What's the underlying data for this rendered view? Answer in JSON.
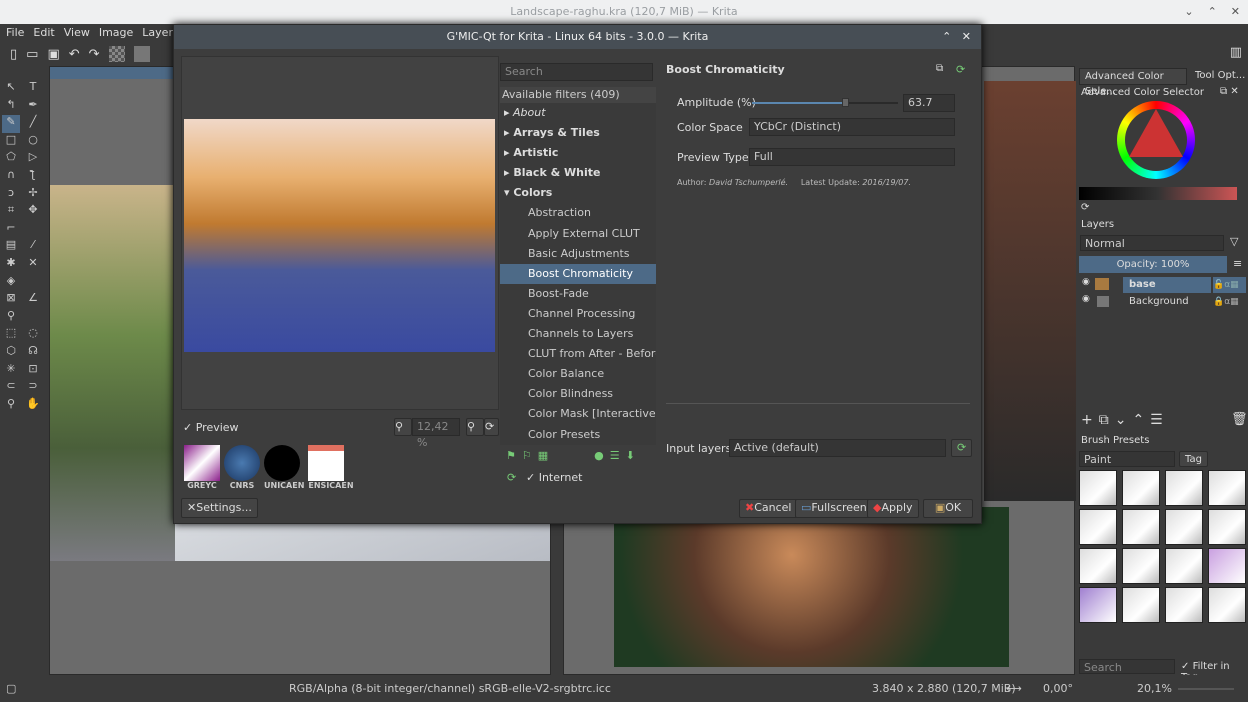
{
  "window": {
    "title": "Landscape-raghu.kra (120,7 MiB) — Krita",
    "controls": [
      "⌄",
      "⌃",
      "✕"
    ]
  },
  "menu": [
    "File",
    "Edit",
    "View",
    "Image",
    "Layer",
    "S"
  ],
  "toolbar": {
    "icons": [
      "new-document-icon",
      "open-icon",
      "save-icon",
      "undo-icon",
      "redo-icon"
    ]
  },
  "dialog": {
    "title": "G'MIC-Qt for Krita - Linux 64 bits - 3.0.0 — Krita",
    "preview_label": "Preview",
    "preview_checked": true,
    "zoom": "12,42 %",
    "logos": [
      "GREYC",
      "CNRS",
      "UNICAEN",
      "ENSICAEN"
    ],
    "settings_label": "Settings...",
    "search_placeholder": "Search",
    "filters_header": "Available filters (409)",
    "filters": [
      {
        "label": "About",
        "type": "cat-italic"
      },
      {
        "label": "Arrays & Tiles",
        "type": "cat"
      },
      {
        "label": "Artistic",
        "type": "cat"
      },
      {
        "label": "Black & White",
        "type": "cat"
      },
      {
        "label": "Colors",
        "type": "cat-open"
      },
      {
        "label": "Abstraction",
        "type": "item"
      },
      {
        "label": "Apply External CLUT",
        "type": "item"
      },
      {
        "label": "Basic Adjustments",
        "type": "item"
      },
      {
        "label": "Boost Chromaticity",
        "type": "selected"
      },
      {
        "label": "Boost-Fade",
        "type": "item"
      },
      {
        "label": "Channel Processing",
        "type": "item"
      },
      {
        "label": "Channels to Layers",
        "type": "item"
      },
      {
        "label": "CLUT from After - Before",
        "type": "item"
      },
      {
        "label": "Color Balance",
        "type": "item"
      },
      {
        "label": "Color Blindness",
        "type": "item"
      },
      {
        "label": "Color Mask [Interactive]",
        "type": "item"
      },
      {
        "label": "Color Presets",
        "type": "item"
      }
    ],
    "internet_label": "Internet",
    "internet_checked": true,
    "filter_title": "Boost Chromaticity",
    "params": {
      "amplitude_label": "Amplitude (%)",
      "amplitude_value": "63.7",
      "amplitude_fraction": 0.637,
      "colorspace_label": "Color Space",
      "colorspace_value": "YCbCr (Distinct)",
      "preview_type_label": "Preview Type",
      "preview_type_value": "Full",
      "author_label": "Author:",
      "author": "David Tschumperlé.",
      "update_label": "Latest Update:",
      "update": "2016/19/07."
    },
    "input_layers_label": "Input layers",
    "input_layers_value": "Active (default)",
    "buttons": {
      "cancel": "Cancel",
      "fullscreen": "Fullscreen",
      "apply": "Apply",
      "ok": "OK"
    }
  },
  "dock": {
    "tabs": [
      "Advanced Color Sele...",
      "Tool Opt..."
    ],
    "color_selector_title": "Advanced Color Selector",
    "layers_title": "Layers",
    "blend_mode": "Normal",
    "opacity": "Opacity:  100%",
    "layers": [
      {
        "name": "base",
        "selected": true
      },
      {
        "name": "Background",
        "selected": false,
        "locked": true
      }
    ],
    "brush_title": "Brush Presets",
    "brush_tag_filter": "Paint",
    "tag_label": "Tag",
    "brush_search_placeholder": "Search",
    "filter_in_tag": "Filter in Tag"
  },
  "status": {
    "colorspace": "RGB/Alpha (8-bit integer/channel)  sRGB-elle-V2-srgbtrc.icc",
    "size": "3.840 x 2.880 (120,7 MiB)",
    "rotation": "0,00°",
    "zoom": "20,1%"
  },
  "colors": {
    "accent": "#4d6a87",
    "dialog_title": "#474e55"
  }
}
